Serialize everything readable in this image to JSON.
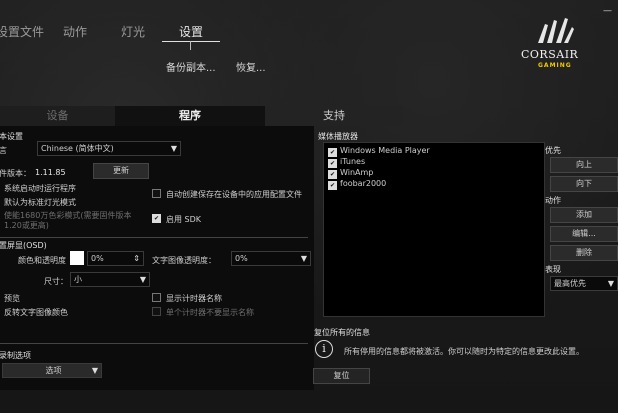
{
  "top_nav": {
    "profiles": "设置文件",
    "actions": "动作",
    "lighting": "灯光",
    "settings": "设置"
  },
  "settings_submenu": {
    "backup": "备份副本...",
    "restore": "恢复..."
  },
  "brand": {
    "name": "CORSAIR",
    "tagline": "GAMING"
  },
  "window_controls": {
    "minimize": "—"
  },
  "tabs": {
    "device": "设备",
    "program": "程序",
    "support": "支持"
  },
  "basic_settings": {
    "title": "本设置",
    "language_label": "言",
    "language_value": "Chinese (简体中文)",
    "firmware_label": "件版本：",
    "firmware_version": "1.11.85",
    "update_button": "更新",
    "launch_on_startup": "系统启动时运行程序",
    "default_standard_lighting": "默认为标准灯光模式",
    "16m_color_mode": "使能1680万色彩模式(需要固件版本1.20或更高)",
    "auto_create_profiles": "自动创建保存在设备中的应用配置文件",
    "enable_sdk": "启用 SDK"
  },
  "osd": {
    "title": "置屏显(OSD)",
    "bg_opacity_label": "颜色和透明度",
    "bg_opacity_value": "0%",
    "text_opacity_label": "文字图像透明度：",
    "text_opacity_value": "0%",
    "size_label": "尺寸：",
    "size_value": "小",
    "preview": "预览",
    "invert_text_color": "反转文字图像颜色",
    "show_timer_name": "显示计时器名称",
    "single_timer_hide_name": "单个计时器不要显示名称"
  },
  "recording": {
    "title": "录制选项",
    "options_button": "选项"
  },
  "media_players": {
    "title": "媒体播放器",
    "items": [
      "Windows Media Player",
      "iTunes",
      "WinAmp",
      "foobar2000"
    ],
    "priority_title": "优先",
    "up_button": "向上",
    "down_button": "向下",
    "actions_title": "动作",
    "add_button": "添加",
    "edit_button": "编辑...",
    "delete_button": "删除",
    "display_title": "表现",
    "display_value": "最高优先"
  },
  "reset": {
    "title": "复位所有的信息",
    "message": "所有停用的信息都将被激活。你可以随时为特定的信息更改此设置。",
    "button": "复位"
  }
}
